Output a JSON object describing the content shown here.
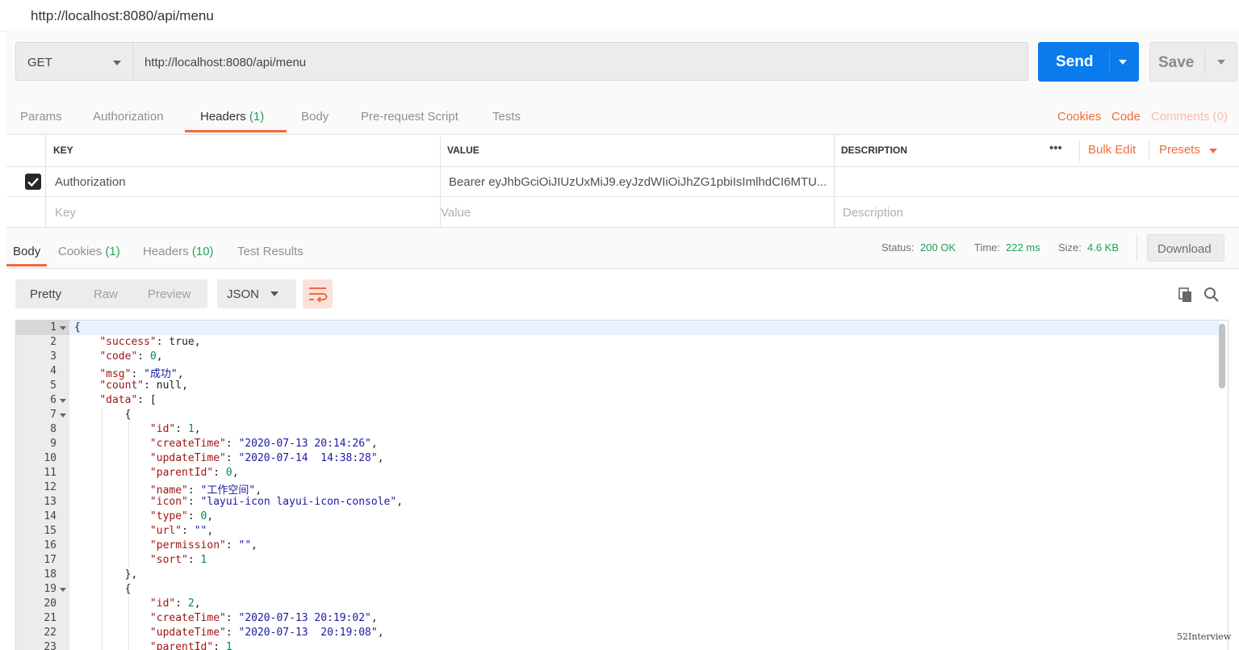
{
  "window": {
    "title": "http://localhost:8080/api/menu"
  },
  "request": {
    "method": "GET",
    "url": "http://localhost:8080/api/menu",
    "send_label": "Send",
    "save_label": "Save"
  },
  "request_tabs": {
    "params": "Params",
    "authorization": "Authorization",
    "headers": "Headers",
    "headers_count": "(1)",
    "body": "Body",
    "prerequest": "Pre-request Script",
    "tests": "Tests",
    "cookies": "Cookies",
    "code": "Code",
    "comments": "Comments (0)"
  },
  "headers_table": {
    "col_key": "KEY",
    "col_value": "VALUE",
    "col_description": "DESCRIPTION",
    "more": "•••",
    "bulk_edit": "Bulk Edit",
    "presets": "Presets",
    "rows": [
      {
        "key": "Authorization",
        "value": "Bearer eyJhbGciOiJIUzUxMiJ9.eyJzdWIiOiJhZG1pbiIsImlhdCI6MTU...",
        "description": ""
      }
    ],
    "placeholder": {
      "key": "Key",
      "value": "Value",
      "description": "Description"
    }
  },
  "response_tabs": {
    "body": "Body",
    "cookies": "Cookies",
    "cookies_count": "(1)",
    "headers": "Headers",
    "headers_count": "(10)",
    "test_results": "Test Results"
  },
  "response_status": {
    "status_label": "Status:",
    "status_value": "200 OK",
    "time_label": "Time:",
    "time_value": "222 ms",
    "size_label": "Size:",
    "size_value": "4.6 KB",
    "download_label": "Download"
  },
  "view": {
    "pretty": "Pretty",
    "raw": "Raw",
    "preview": "Preview",
    "format": "JSON"
  },
  "icons": {
    "wrap": "wrap-lines-icon",
    "copy": "copy-icon",
    "search": "search-icon"
  },
  "colors": {
    "accent": "#f26b3a",
    "send": "#097bed",
    "success": "#23a15b"
  },
  "code_lines": [
    {
      "n": "1",
      "fold": true
    },
    {
      "n": "2"
    },
    {
      "n": "3"
    },
    {
      "n": "4"
    },
    {
      "n": "5"
    },
    {
      "n": "6",
      "fold": true
    },
    {
      "n": "7",
      "fold": true
    },
    {
      "n": "8"
    },
    {
      "n": "9"
    },
    {
      "n": "10"
    },
    {
      "n": "11"
    },
    {
      "n": "12"
    },
    {
      "n": "13"
    },
    {
      "n": "14"
    },
    {
      "n": "15"
    },
    {
      "n": "16"
    },
    {
      "n": "17"
    },
    {
      "n": "18"
    },
    {
      "n": "19",
      "fold": true
    },
    {
      "n": "20"
    },
    {
      "n": "21"
    },
    {
      "n": "22"
    },
    {
      "n": "23"
    }
  ],
  "code": {
    "l1": "{",
    "l2k": "\"success\"",
    "l2v": " true,",
    "l3k": "\"code\"",
    "l3v": "0",
    "l4k": "\"msg\"",
    "l4v": "\"成功\"",
    "l5k": "\"count\"",
    "l5v": " null,",
    "l6k": "\"data\"",
    "l6v": " [",
    "l7": "{",
    "l8k": "\"id\"",
    "l8v": "1",
    "l9k": "\"createTime\"",
    "l9v": "\"2020-07-13 20:14:26\"",
    "l10k": "\"updateTime\"",
    "l10v": "\"2020-07-14  14:38:28\"",
    "l11k": "\"parentId\"",
    "l11v": "0",
    "l12k": "\"name\"",
    "l12v": "\"工作空间\"",
    "l13k": "\"icon\"",
    "l13v": "\"layui-icon layui-icon-console\"",
    "l14k": "\"type\"",
    "l14v": "0",
    "l15k": "\"url\"",
    "l15v": "\"\"",
    "l16k": "\"permission\"",
    "l16v": "\"\"",
    "l17k": "\"sort\"",
    "l17v": "1",
    "l18": "},",
    "l19": "{",
    "l20k": "\"id\"",
    "l20v": "2",
    "l21k": "\"createTime\"",
    "l21v": "\"2020-07-13 20:19:02\"",
    "l22k": "\"updateTime\"",
    "l22v": "\"2020-07-13  20:19:08\"",
    "l23k": "\"parentId\"",
    "l23v": "1"
  },
  "watermark": "52Interview"
}
